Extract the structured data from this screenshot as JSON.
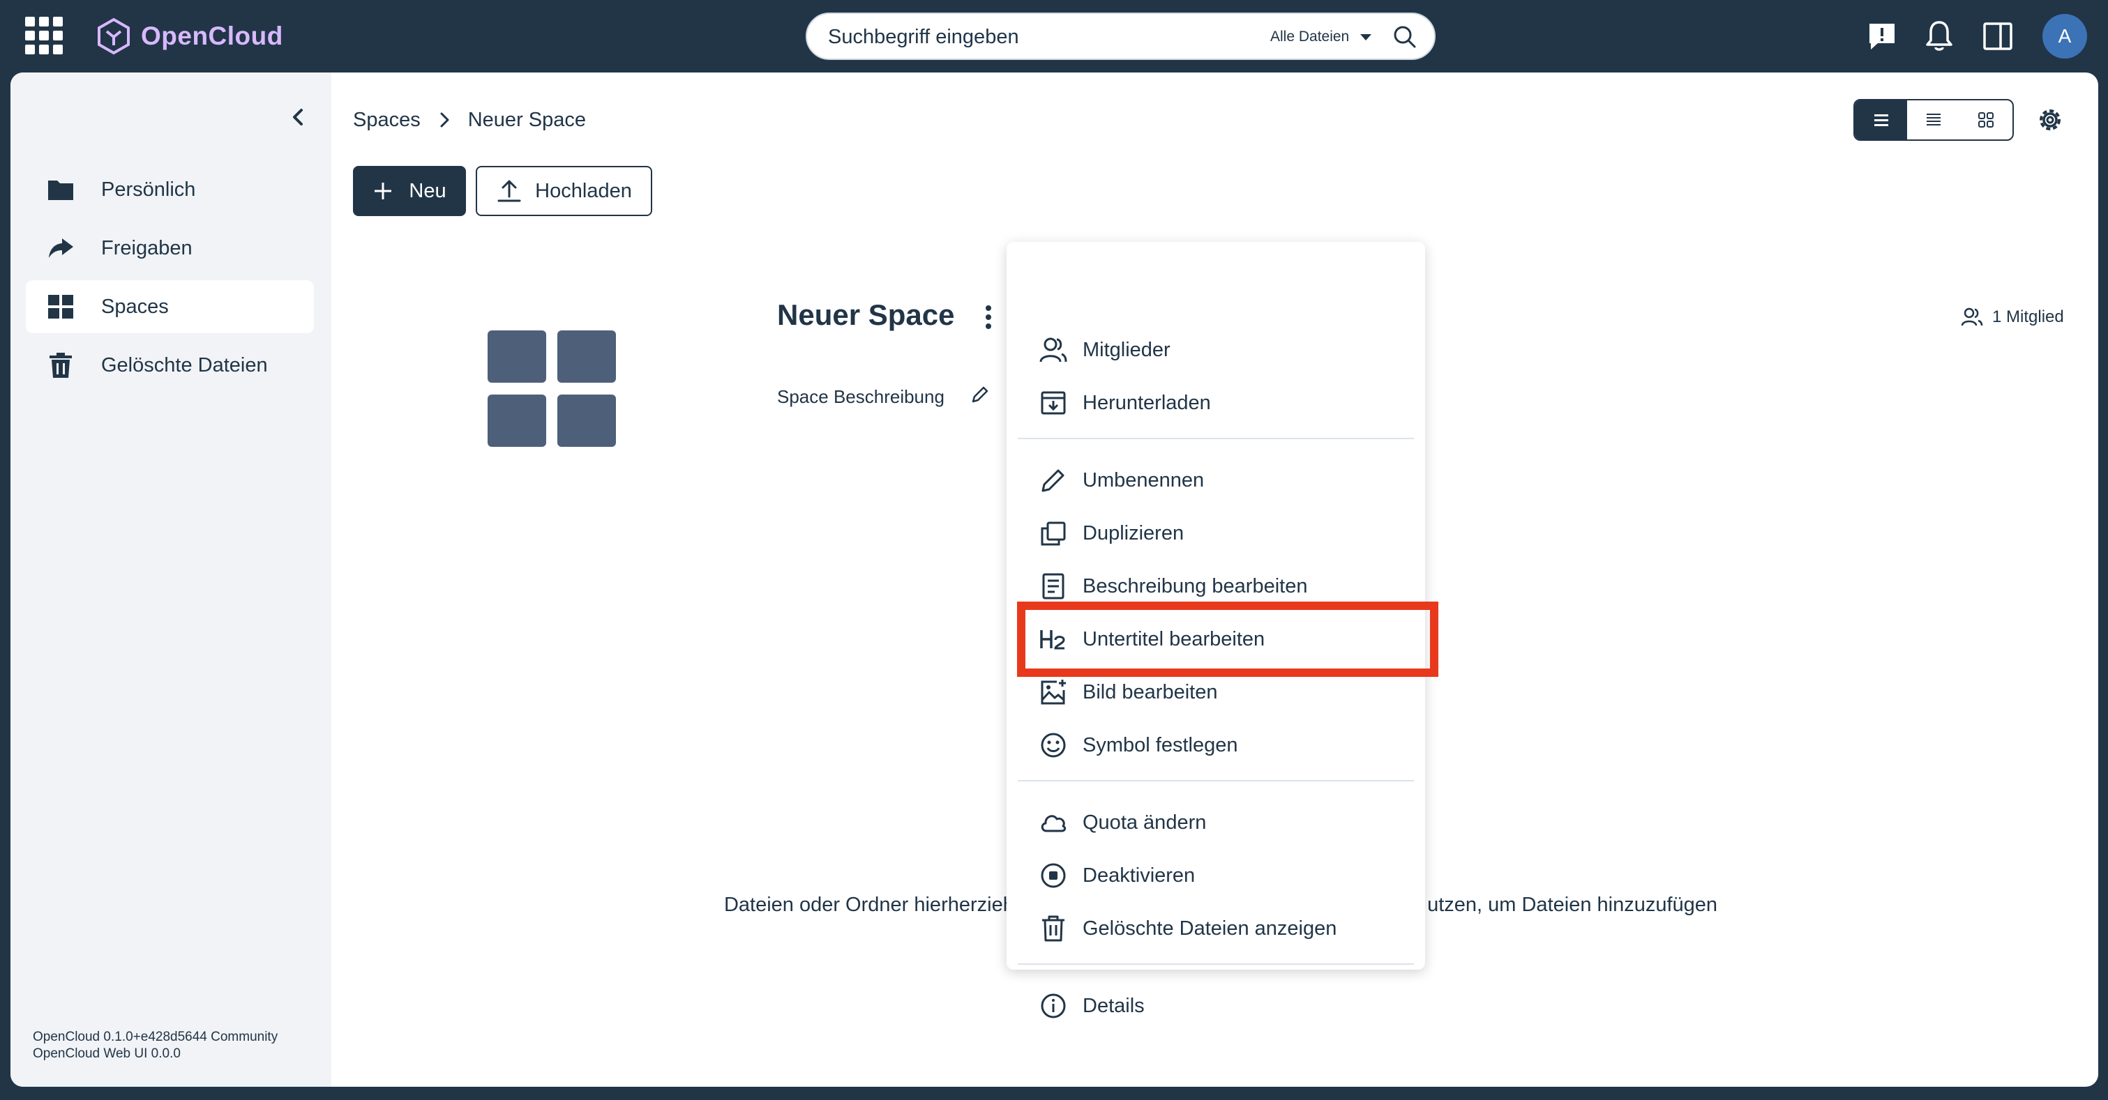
{
  "app": {
    "brand": "OpenCloud",
    "avatar_letter": "A"
  },
  "search": {
    "placeholder": "Suchbegriff eingeben",
    "scope_label": "Alle Dateien"
  },
  "sidebar": {
    "items": [
      {
        "label": "Persönlich",
        "icon": "folder-icon",
        "active": false
      },
      {
        "label": "Freigaben",
        "icon": "share-icon",
        "active": false
      },
      {
        "label": "Spaces",
        "icon": "spaces-grid-icon",
        "active": true
      },
      {
        "label": "Gelöschte Dateien",
        "icon": "trash-icon",
        "active": false
      }
    ],
    "version_line1": "OpenCloud 0.1.0+e428d5644 Community",
    "version_line2": "OpenCloud Web UI 0.0.0"
  },
  "breadcrumb": {
    "root": "Spaces",
    "current": "Neuer Space"
  },
  "toolbar": {
    "new_label": "Neu",
    "upload_label": "Hochladen",
    "view_mode": "list"
  },
  "space": {
    "title": "Neuer Space",
    "description": "Space Beschreibung",
    "members": "1 Mitglied"
  },
  "dropzone": {
    "left_text": "Dateien oder Ordner hierherziehen",
    "right_text": "utzen, um Dateien hinzuzufügen"
  },
  "context_menu": {
    "items": [
      {
        "label": "Mitglieder",
        "icon": "members-icon"
      },
      {
        "label": "Herunterladen",
        "icon": "download-icon"
      },
      {
        "label": "Umbenennen",
        "icon": "pencil-icon"
      },
      {
        "label": "Duplizieren",
        "icon": "duplicate-icon"
      },
      {
        "label": "Beschreibung bearbeiten",
        "icon": "description-icon"
      },
      {
        "label": "Untertitel bearbeiten",
        "icon": "heading-h2-icon",
        "highlighted": true
      },
      {
        "label": "Bild bearbeiten",
        "icon": "image-add-icon"
      },
      {
        "label": "Symbol festlegen",
        "icon": "emoji-icon"
      },
      {
        "label": "Quota ändern",
        "icon": "cloud-icon"
      },
      {
        "label": "Deaktivieren",
        "icon": "stop-circle-icon"
      },
      {
        "label": "Gelöschte Dateien anzeigen",
        "icon": "trash-icon"
      },
      {
        "label": "Details",
        "icon": "info-icon"
      }
    ]
  },
  "colors": {
    "topbar": "#213547",
    "brand": "#d9b8ff",
    "highlight": "#e8391d",
    "avatar": "#3c73b7"
  }
}
